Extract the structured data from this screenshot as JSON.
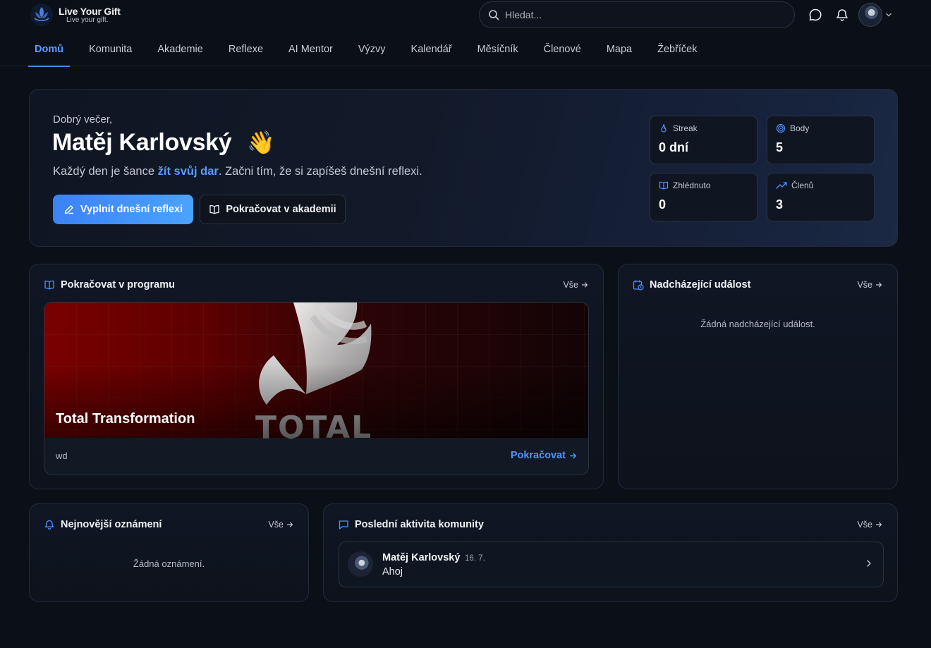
{
  "brand": {
    "title": "Live Your Gift",
    "tagline": "Live your gift."
  },
  "search": {
    "placeholder": "Hledat..."
  },
  "nav": {
    "items": [
      {
        "label": "Domů",
        "active": true
      },
      {
        "label": "Komunita"
      },
      {
        "label": "Akademie"
      },
      {
        "label": "Reflexe"
      },
      {
        "label": "AI Mentor"
      },
      {
        "label": "Výzvy"
      },
      {
        "label": "Kalendář"
      },
      {
        "label": "Měsíčník"
      },
      {
        "label": "Členové"
      },
      {
        "label": "Mapa"
      },
      {
        "label": "Žebříček"
      }
    ]
  },
  "hero": {
    "greeting": "Dobrý večer,",
    "name": "Matěj Karlovský",
    "emoji": "👋",
    "subtitle_pre": "Každý den je šance ",
    "subtitle_highlight": "žít svůj dar",
    "subtitle_post": ". Začni tím, že si zapíšeš dnešní reflexi.",
    "primary_button": "Vyplnit dnešní reflexi",
    "secondary_button": "Pokračovat v akademii",
    "stats": [
      {
        "label": "Streak",
        "value": "0 dní",
        "icon": "flame-icon"
      },
      {
        "label": "Body",
        "value": "5",
        "icon": "target-icon"
      },
      {
        "label": "Zhlédnuto",
        "value": "0",
        "icon": "book-icon"
      },
      {
        "label": "Členů",
        "value": "3",
        "icon": "trending-up-icon"
      }
    ]
  },
  "program": {
    "title": "Pokračovat v programu",
    "see_all": "Vše",
    "course_title": "Total Transformation",
    "banner_word": "TOTAL",
    "description": "wd",
    "continue_label": "Pokračovat"
  },
  "events": {
    "title": "Nadcházející událost",
    "see_all": "Vše",
    "empty": "Žádná nadcházející událost."
  },
  "news": {
    "title": "Nejnovější oznámení",
    "see_all": "Vše",
    "empty": "Žádná oznámení."
  },
  "activity": {
    "title": "Poslední aktivita komunity",
    "see_all": "Vše",
    "items": [
      {
        "name": "Matěj Karlovský",
        "date": "16. 7.",
        "text": "Ahoj"
      }
    ]
  },
  "colors": {
    "accent": "#3d8bff",
    "background": "#0b0f18",
    "card": "#101624"
  }
}
